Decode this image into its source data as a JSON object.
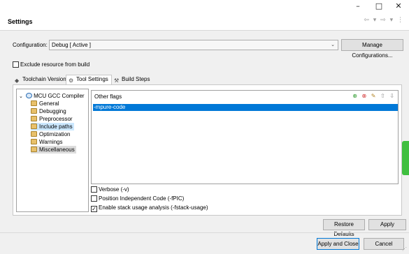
{
  "window": {
    "minimize_glyph": "–",
    "maximize_glyph": "□",
    "close_glyph": "✕"
  },
  "header": {
    "title": "Settings",
    "nav_back": "⇦",
    "nav_forward": "⇨",
    "dropdown": "▾",
    "menu": "⋮"
  },
  "configuration": {
    "label": "Configuration:",
    "value": "Debug  [ Active ]",
    "manage_label": "Manage Configurations..."
  },
  "exclude": {
    "label": "Exclude resource from build",
    "checked": false
  },
  "tabs": [
    {
      "label": "Toolchain Version",
      "icon": "toolchain-icon"
    },
    {
      "label": "Tool Settings",
      "icon": "gear-icon"
    },
    {
      "label": "Build Steps",
      "icon": "wrench-icon"
    }
  ],
  "tree": {
    "root": "MCU GCC Compiler",
    "items": [
      "General",
      "Debugging",
      "Preprocessor",
      "Include paths",
      "Optimization",
      "Warnings",
      "Miscellaneous"
    ]
  },
  "flags": {
    "title": "Other flags",
    "items": [
      "-mpure-code"
    ]
  },
  "options": [
    {
      "label": "Verbose (-v)",
      "checked": false
    },
    {
      "label": "Position Independent Code (-fPIC)",
      "checked": false
    },
    {
      "label": "Enable stack usage analysis (-fstack-usage)",
      "checked": true
    }
  ],
  "buttons": {
    "restore": "Restore Defaults",
    "apply": "Apply",
    "apply_close": "Apply and Close",
    "cancel": "Cancel"
  },
  "colors": {
    "selection": "#0078d7",
    "side_tab": "#3fbf3f"
  }
}
